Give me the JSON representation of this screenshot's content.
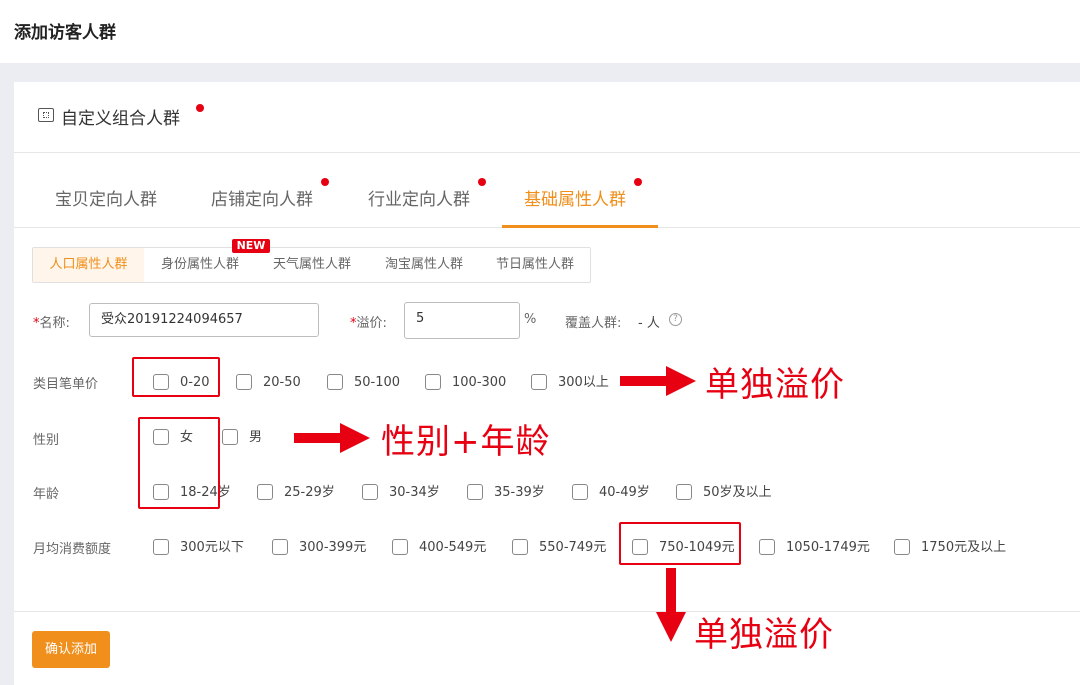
{
  "page": {
    "title": "添加访客人群"
  },
  "section": {
    "title": "自定义组合人群"
  },
  "tabs": [
    {
      "label": "宝贝定向人群"
    },
    {
      "label": "店铺定向人群"
    },
    {
      "label": "行业定向人群"
    },
    {
      "label": "基础属性人群"
    }
  ],
  "subtabs": [
    {
      "label": "人口属性人群"
    },
    {
      "label": "身份属性人群"
    },
    {
      "label": "天气属性人群"
    },
    {
      "label": "淘宝属性人群"
    },
    {
      "label": "节日属性人群"
    }
  ],
  "new_badge": "NEW",
  "form": {
    "required_mark": "*",
    "name_label": "名称:",
    "name_value": "受众20191224094657",
    "premium_label": "溢价:",
    "premium_value": "5",
    "premium_unit": "%",
    "coverage_label": "覆盖人群:",
    "coverage_value": "- 人",
    "help_glyph": "?"
  },
  "filters": {
    "price": {
      "label": "类目笔单价",
      "options": [
        "0-20",
        "20-50",
        "50-100",
        "100-300",
        "300以上"
      ]
    },
    "gender": {
      "label": "性别",
      "options": [
        "女",
        "男"
      ]
    },
    "age": {
      "label": "年龄",
      "options": [
        "18-24岁",
        "25-29岁",
        "30-34岁",
        "35-39岁",
        "40-49岁",
        "50岁及以上"
      ]
    },
    "spend": {
      "label": "月均消费额度",
      "options": [
        "300元以下",
        "300-399元",
        "400-549元",
        "550-749元",
        "750-1049元",
        "1050-1749元",
        "1750元及以上"
      ]
    }
  },
  "confirm_button": "确认添加",
  "annotations": {
    "price_note": "单独溢价",
    "gender_age_note": "性别+年龄",
    "spend_note": "单独溢价"
  },
  "colors": {
    "accent": "#f08f1b",
    "annotation": "#e60012"
  }
}
